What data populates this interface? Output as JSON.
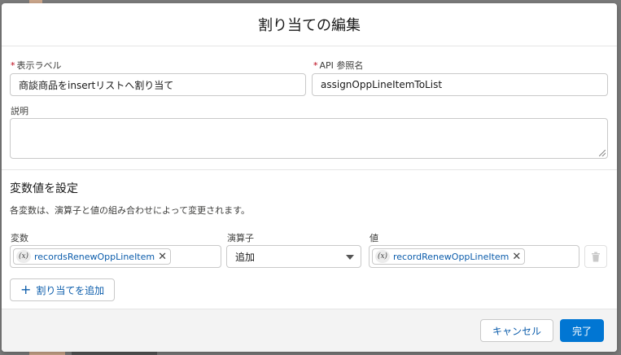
{
  "modal": {
    "title": "割り当ての編集"
  },
  "fields": {
    "label": {
      "required_mark": "*",
      "label": "表示ラベル",
      "value": "商談商品をinsertリストへ割り当て"
    },
    "api_name": {
      "required_mark": "*",
      "label": "API 参照名",
      "value": "assignOppLineItemToList"
    },
    "description": {
      "label": "説明",
      "value": ""
    }
  },
  "section": {
    "title": "変数値を設定",
    "description": "各変数は、演算子と値の組み合わせによって変更されます。"
  },
  "assignment": {
    "variable_header": "変数",
    "operator_header": "演算子",
    "value_header": "値",
    "variable_icon": "(x)",
    "variable": "recordsRenewOppLineItem",
    "operator": "追加",
    "value_icon": "(x)",
    "value": "recordRenewOppLineItem",
    "remove_glyph": "✕"
  },
  "add_button": {
    "plus": "+",
    "label": "割り当てを追加"
  },
  "footer": {
    "cancel": "キャンセル",
    "done": "完了"
  },
  "colors": {
    "brand": "#0176d3",
    "link": "#0b5cab",
    "required": "#ba0517"
  },
  "icons": [
    "variable-icon",
    "close-icon",
    "trash-icon",
    "plus-icon",
    "chevron-down-icon"
  ]
}
